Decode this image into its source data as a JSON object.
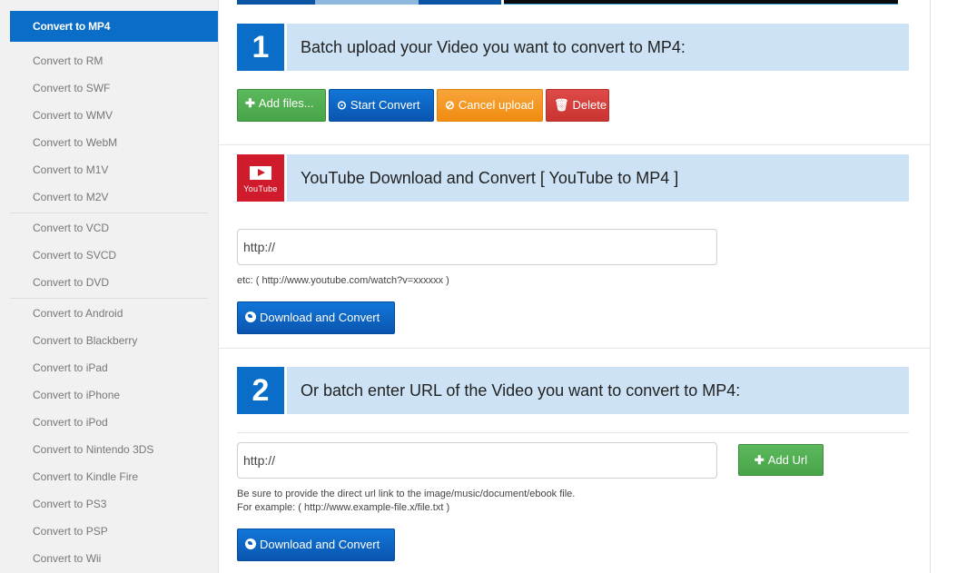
{
  "sidebar": {
    "active": "Convert to MP4",
    "groups": [
      [
        "Convert to RM",
        "Convert to SWF",
        "Convert to WMV",
        "Convert to WebM",
        "Convert to M1V",
        "Convert to M2V"
      ],
      [
        "Convert to VCD",
        "Convert to SVCD",
        "Convert to DVD"
      ],
      [
        "Convert to Android",
        "Convert to Blackberry",
        "Convert to iPad",
        "Convert to iPhone",
        "Convert to iPod",
        "Convert to Nintendo 3DS",
        "Convert to Kindle Fire",
        "Convert to PS3",
        "Convert to PSP",
        "Convert to Wii"
      ]
    ]
  },
  "step1": {
    "number": "1",
    "title": "Batch upload your Video you want to convert to MP4:",
    "buttons": {
      "add_files": "Add files...",
      "start_convert": "Start Convert",
      "cancel_upload": "Cancel upload",
      "delete": "Delete"
    }
  },
  "youtube": {
    "icon_label": "YouTube",
    "title": "YouTube Download and Convert [ YouTube to MP4 ]",
    "input_value": "http://",
    "hint": "etc: ( http://www.youtube.com/watch?v=xxxxxx )",
    "button": "Download and Convert"
  },
  "step2": {
    "number": "2",
    "title": "Or batch enter URL of the Video you want to convert to MP4:",
    "input_value": "http://",
    "add_url": "Add Url",
    "hint_line1": "Be sure to provide the direct url link to the image/music/document/ebook file.",
    "hint_line2": "For example: ( http://www.example-file.x/file.txt )",
    "button": "Download and Convert"
  },
  "colors": {
    "primary": "#0a6ec8",
    "header_bg": "#cde3f5",
    "green": "#5cb85c",
    "orange": "#f08c10",
    "red": "#c93431",
    "youtube_red": "#cf1b2b"
  }
}
